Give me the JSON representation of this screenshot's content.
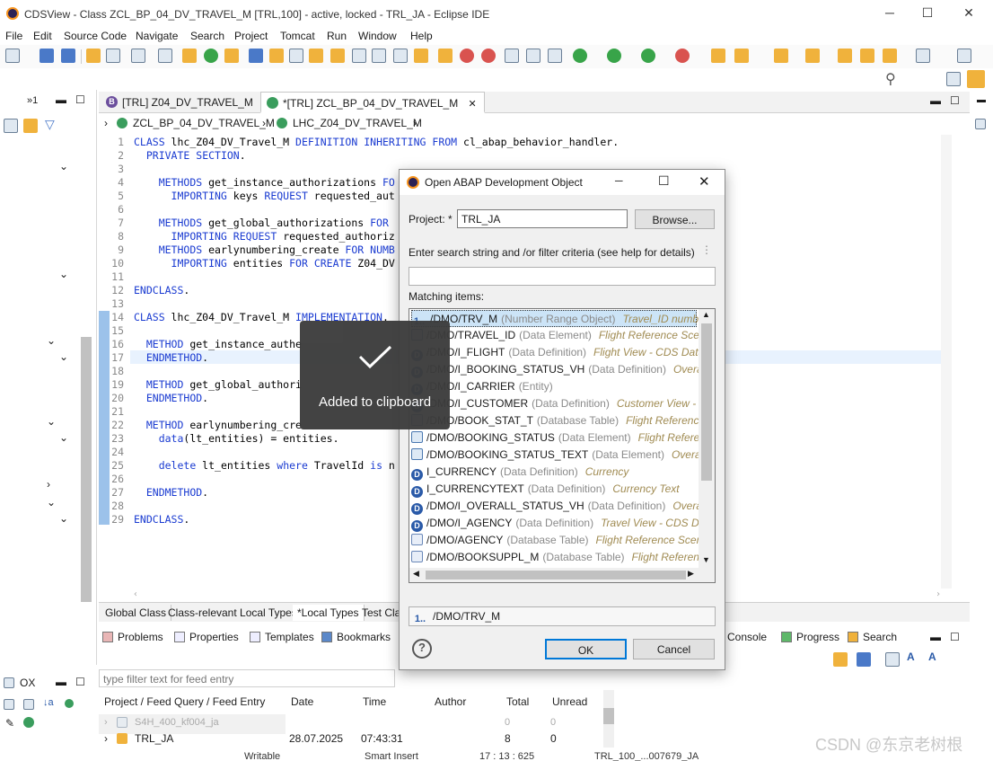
{
  "window": {
    "title": "CDSView - Class ZCL_BP_04_DV_TRAVEL_M [TRL,100] - active, locked - TRL_JA - Eclipse IDE",
    "controls": {
      "minimize": "─",
      "maximize": "☐",
      "close": "✕"
    }
  },
  "menu": [
    "File",
    "Edit",
    "Source Code",
    "Navigate",
    "Search",
    "Project",
    "Tomcat",
    "Run",
    "Window",
    "Help"
  ],
  "left_pane": {
    "max_label": "»1"
  },
  "editor": {
    "tabs": [
      {
        "label": "[TRL] Z04_DV_TRAVEL_M",
        "icon": "behavior-definition-icon",
        "active": false
      },
      {
        "label": "*[TRL] ZCL_BP_04_DV_TRAVEL_M",
        "icon": "class-icon",
        "active": true,
        "close": "✕"
      }
    ],
    "breadcrumb": [
      "ZCL_BP_04_DV_TRAVEL_M",
      "LHC_Z04_DV_TRAVEL_M"
    ],
    "lines": [
      {
        "n": "1",
        "code": "CLASS lhc_Z04_DV_Travel_M DEFINITION INHERITING FROM cl_abap_behavior_handler."
      },
      {
        "n": "2",
        "code": "  PRIVATE SECTION."
      },
      {
        "n": "3",
        "code": ""
      },
      {
        "n": "4",
        "code": "    METHODS get_instance_authorizations FO"
      },
      {
        "n": "5",
        "code": "      IMPORTING keys REQUEST requested_aut"
      },
      {
        "n": "6",
        "code": ""
      },
      {
        "n": "7",
        "code": "    METHODS get_global_authorizations FOR"
      },
      {
        "n": "8",
        "code": "      IMPORTING REQUEST requested_authoriz"
      },
      {
        "n": "9",
        "code": "    METHODS earlynumbering_create FOR NUMB"
      },
      {
        "n": "10",
        "code": "      IMPORTING entities FOR CREATE Z04_DV"
      },
      {
        "n": "11",
        "code": ""
      },
      {
        "n": "12",
        "code": "ENDCLASS."
      },
      {
        "n": "13",
        "code": ""
      },
      {
        "n": "14",
        "code": "CLASS lhc_Z04_DV_Travel_M IMPLEMENTATION."
      },
      {
        "n": "15",
        "code": ""
      },
      {
        "n": "16",
        "code": "  METHOD get_instance_authe"
      },
      {
        "n": "17",
        "code": "  ENDMETHOD."
      },
      {
        "n": "18",
        "code": ""
      },
      {
        "n": "19",
        "code": "  METHOD get_global_authori"
      },
      {
        "n": "20",
        "code": "  ENDMETHOD."
      },
      {
        "n": "21",
        "code": ""
      },
      {
        "n": "22",
        "code": "  METHOD earlynumbering_cre"
      },
      {
        "n": "23",
        "code": "    data(lt_entities) = entities."
      },
      {
        "n": "24",
        "code": ""
      },
      {
        "n": "25",
        "code": "    delete lt_entities where TravelId is n"
      },
      {
        "n": "26",
        "code": ""
      },
      {
        "n": "27",
        "code": "  ENDMETHOD."
      },
      {
        "n": "28",
        "code": ""
      },
      {
        "n": "29",
        "code": "ENDCLASS."
      }
    ],
    "bottom_tabs": [
      "Global Class",
      "Class-relevant Local Types",
      "*Local Types",
      "Test Cla"
    ]
  },
  "views": {
    "left": [
      "Problems",
      "Properties",
      "Templates",
      "Bookmarks"
    ],
    "right": [
      "Console",
      "Progress",
      "Search"
    ]
  },
  "feed": {
    "tab_label": "OX",
    "filter_placeholder": "type filter text for feed entry",
    "columns": [
      "Project / Feed Query / Feed Entry",
      "Date",
      "Time",
      "Author",
      "Total",
      "Unread"
    ],
    "rows": [
      {
        "name": "S4H_400_kf004_ja",
        "date": "",
        "time": "",
        "author": "",
        "total": "0",
        "unread": "0",
        "dim": true
      },
      {
        "name": "TRL_JA",
        "date": "28.07.2025",
        "time": "07:43:31",
        "author": "",
        "total": "8",
        "unread": "0",
        "dim": false
      }
    ]
  },
  "statusbar": {
    "mode": "Writable",
    "insert": "Smart Insert",
    "pos": "17 : 13 : 625",
    "system": "TRL_100_...007679_JA"
  },
  "dialog": {
    "title": "Open ABAP Development Object",
    "project_label": "Project: *",
    "project_value": "TRL_JA",
    "browse_label": "Browse...",
    "search_label": "Enter search string and /or filter criteria (see help for details)",
    "search_value": "",
    "matching_label": "Matching items:",
    "items": [
      {
        "icon": "n",
        "name": "/DMO/TRV_M",
        "type": "(Number Range Object)",
        "desc": "Travel_ID numbe",
        "selected": true
      },
      {
        "icon": "e",
        "name": "/DMO/TRAVEL_ID",
        "type": "(Data Element)",
        "desc": "Flight Reference Scena"
      },
      {
        "icon": "d",
        "name": "/DMO/I_FLIGHT",
        "type": "(Data Definition)",
        "desc": "Flight View - CDS Data"
      },
      {
        "icon": "d",
        "name": "/DMO/I_BOOKING_STATUS_VH",
        "type": "(Data Definition)",
        "desc": "Overa"
      },
      {
        "icon": "d",
        "name": "/DMO/I_CARRIER",
        "type": "(Entity)",
        "desc": ""
      },
      {
        "icon": "d",
        "name": "/DMO/I_CUSTOMER",
        "type": "(Data Definition)",
        "desc": "Customer View - C"
      },
      {
        "icon": "t",
        "name": "/DMO/BOOK_STAT_T",
        "type": "(Database Table)",
        "desc": "Flight Reference"
      },
      {
        "icon": "e",
        "name": "/DMO/BOOKING_STATUS",
        "type": "(Data Element)",
        "desc": "Flight Referen"
      },
      {
        "icon": "e",
        "name": "/DMO/BOOKING_STATUS_TEXT",
        "type": "(Data Element)",
        "desc": "Overall S"
      },
      {
        "icon": "d",
        "name": "I_CURRENCY",
        "type": "(Data Definition)",
        "desc": "Currency"
      },
      {
        "icon": "d",
        "name": "I_CURRENCYTEXT",
        "type": "(Data Definition)",
        "desc": "Currency Text"
      },
      {
        "icon": "d",
        "name": "/DMO/I_OVERALL_STATUS_VH",
        "type": "(Data Definition)",
        "desc": "Overall"
      },
      {
        "icon": "d",
        "name": "/DMO/I_AGENCY",
        "type": "(Data Definition)",
        "desc": "Travel View - CDS Da"
      },
      {
        "icon": "t",
        "name": "/DMO/AGENCY",
        "type": "(Database Table)",
        "desc": "Flight Reference Scena"
      },
      {
        "icon": "t",
        "name": "/DMO/BOOKSUPPL_M",
        "type": "(Database Table)",
        "desc": "Flight Referenc"
      }
    ],
    "selected_value": "/DMO/TRV_M",
    "ok_label": "OK",
    "cancel_label": "Cancel",
    "help_label": "?"
  },
  "toast": {
    "message": "Added to clipboard"
  },
  "watermark": "CSDN @东京老树根",
  "colors": {
    "keyword": "#1a3bd1",
    "description": "#a08b52",
    "selection": "#cce4f7",
    "accent": "#0078d7"
  }
}
